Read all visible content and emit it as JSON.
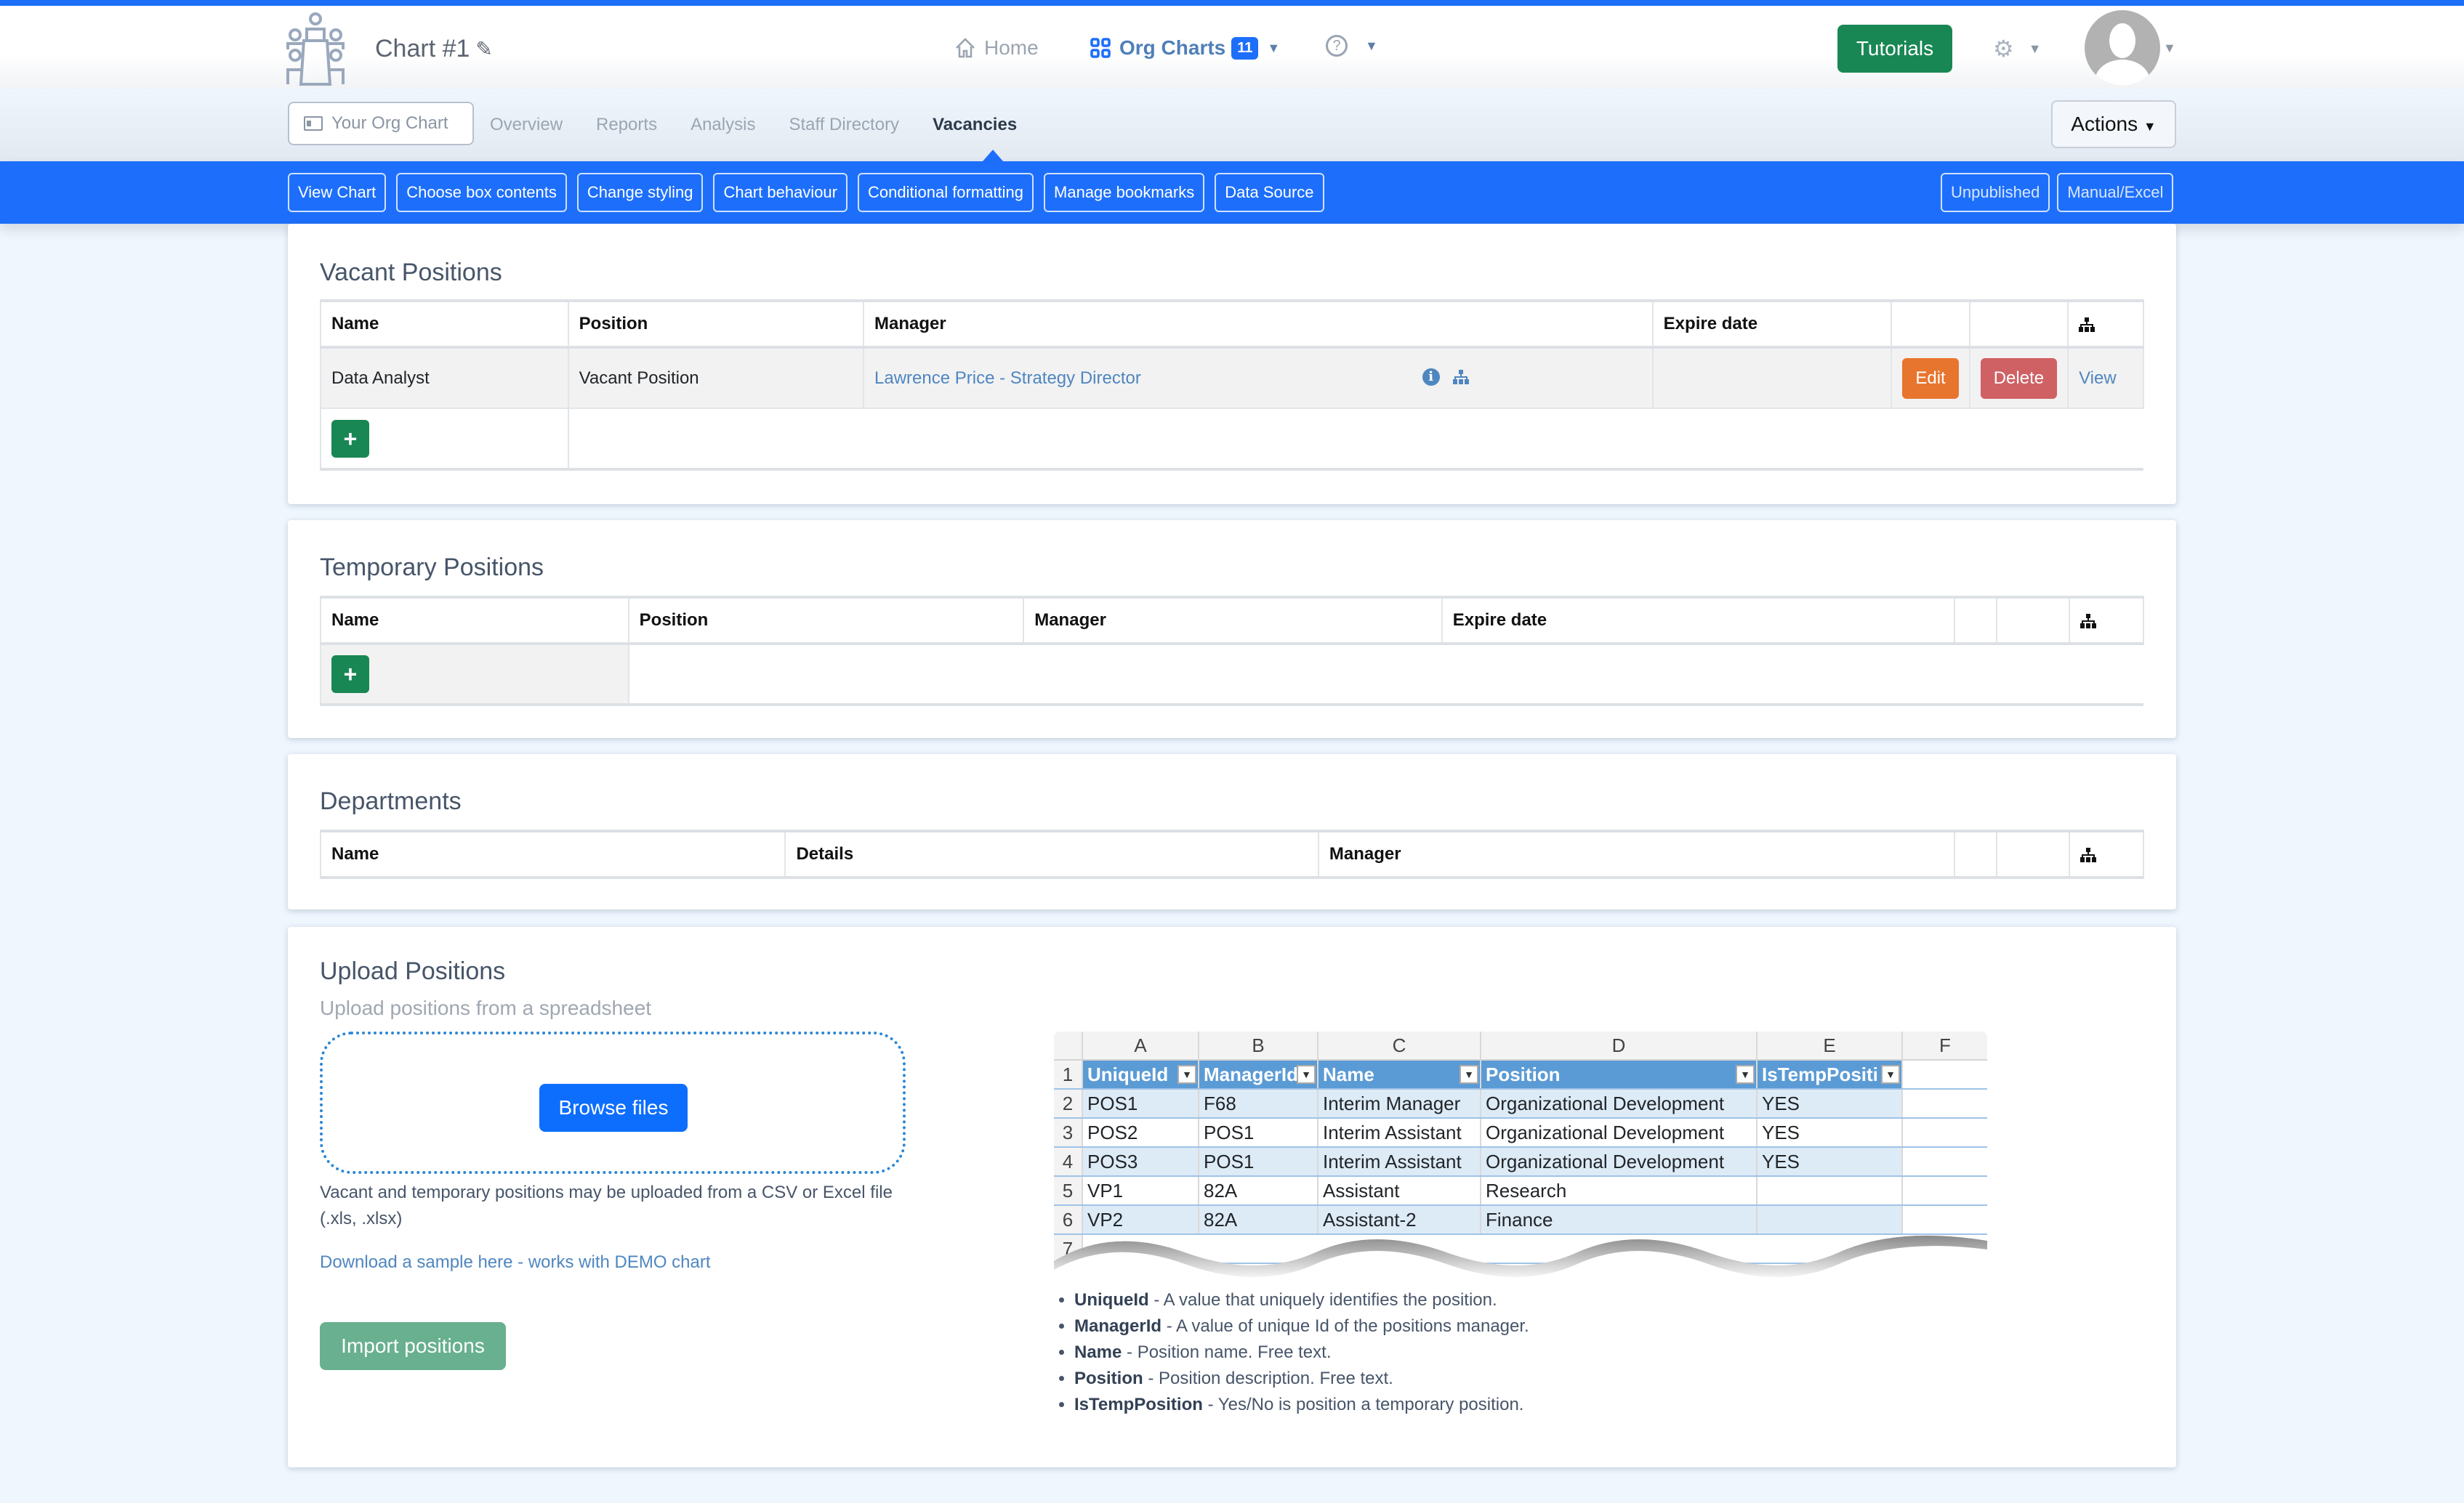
{
  "header": {
    "chart_title": "Chart #1",
    "nav": {
      "home": "Home",
      "org_charts": "Org Charts",
      "org_charts_count": "11"
    },
    "tutorials": "Tutorials"
  },
  "subnav": {
    "your_org_chart": "Your Org Chart",
    "tabs": [
      "Overview",
      "Reports",
      "Analysis",
      "Staff Directory",
      "Vacancies"
    ],
    "active_tab": "Vacancies",
    "actions": "Actions"
  },
  "toolbar": {
    "left": [
      "View Chart",
      "Choose box contents",
      "Change styling",
      "Chart behaviour",
      "Conditional formatting",
      "Manage bookmarks",
      "Data Source"
    ],
    "right": [
      "Unpublished",
      "Manual/Excel"
    ]
  },
  "vacant": {
    "title": "Vacant Positions",
    "columns": [
      "Name",
      "Position",
      "Manager",
      "Expire date"
    ],
    "rows": [
      {
        "name": "Data Analyst",
        "position": "Vacant Position",
        "manager": "Lawrence Price - Strategy Director",
        "expire_date": "",
        "edit": "Edit",
        "delete": "Delete",
        "view": "View"
      }
    ],
    "add": "+"
  },
  "temporary": {
    "title": "Temporary Positions",
    "columns": [
      "Name",
      "Position",
      "Manager",
      "Expire date"
    ],
    "add": "+"
  },
  "departments": {
    "title": "Departments",
    "columns": [
      "Name",
      "Details",
      "Manager"
    ]
  },
  "upload": {
    "title": "Upload Positions",
    "subtitle": "Upload positions from a spreadsheet",
    "browse": "Browse files",
    "help": "Vacant and temporary positions may be uploaded from a CSV or Excel file (.xls, .xlsx)",
    "sample_link": "Download a sample here - works with DEMO chart",
    "import": "Import positions",
    "spreadsheet": {
      "col_letters": [
        "A",
        "B",
        "C",
        "D",
        "E",
        "F"
      ],
      "headers": [
        "UniqueId",
        "ManagerId",
        "Name",
        "Position",
        "IsTempPositi"
      ],
      "rows": [
        [
          "POS1",
          "F68",
          "Interim Manager",
          "Organizational Development",
          "YES"
        ],
        [
          "POS2",
          "POS1",
          "Interim Assistant",
          "Organizational Development",
          "YES"
        ],
        [
          "POS3",
          "POS1",
          "Interim Assistant",
          "Organizational Development",
          "YES"
        ],
        [
          "VP1",
          "82A",
          "Assistant",
          "Research",
          ""
        ],
        [
          "VP2",
          "82A",
          "Assistant-2",
          "Finance",
          ""
        ]
      ],
      "row_numbers": [
        "1",
        "2",
        "3",
        "4",
        "5",
        "6",
        "7"
      ]
    },
    "fields": [
      {
        "name": "UniqueId",
        "desc": " - A value that uniquely identifies the position."
      },
      {
        "name": "ManagerId",
        "desc": " - A value of unique Id of the positions manager."
      },
      {
        "name": "Name",
        "desc": " - Position name. Free text."
      },
      {
        "name": "Position",
        "desc": " - Position description. Free text."
      },
      {
        "name": "IsTempPosition",
        "desc": " - Yes/No is position a temporary position."
      }
    ]
  },
  "colors": {
    "primary": "#1d6ffb",
    "success": "#198754",
    "edit": "#e8752d",
    "delete": "#cf6164",
    "link": "#4f86c0"
  }
}
